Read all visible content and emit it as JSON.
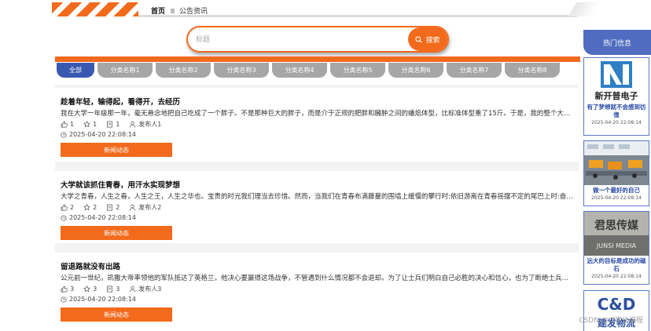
{
  "breadcrumb": {
    "home": "首页",
    "current": "公告资讯"
  },
  "search": {
    "placeholder": "标题",
    "button_label": "搜索"
  },
  "tabs": [
    {
      "label": "全部",
      "active": true
    },
    {
      "label": "分类名称1"
    },
    {
      "label": "分类名称2"
    },
    {
      "label": "分类名称3"
    },
    {
      "label": "分类名称4"
    },
    {
      "label": "分类名称5"
    },
    {
      "label": "分类名称6"
    },
    {
      "label": "分类名称7"
    },
    {
      "label": "分类名称8"
    }
  ],
  "news": [
    {
      "title": "趁着年轻，输得起，看得开，去经历",
      "desc": "我在大学一年级那一年，毫无悬念地把自己吃成了一个胖子。不是那种巨大的胖子，而是介于正规的肥胖和臃肿之间的蟠焰体型，比标准体型重了15斤。于是，我的整个大学生...",
      "likes": "1",
      "favorites": "1",
      "comments": "1",
      "author": "发布人1",
      "time": "2025-04-20 22:08:14",
      "tag": "新闻动态"
    },
    {
      "title": "大学就该抓住青春，用汗水实现梦想",
      "desc": "大学之青春，人生之春，人生之王，人生之华也。宝贵的时光我们理当去珍惜。然而，当我们在青春布满藤蔓的围墙上缓慢的攀行时:依旧游离在青春摇摆不定的尾巴上时:奋力想...",
      "likes": "2",
      "favorites": "2",
      "comments": "2",
      "author": "发布人2",
      "time": "2025-04-20 22:08:14",
      "tag": "新闻动态"
    },
    {
      "title": "留退路就没有出路",
      "desc": "公元前一世纪，凯撒大帝率领他的军队抵达了英格兰，他决心要赢得这场战争，不管遇到什么情况都不会退却。为了让士兵们明白自己必胜的决心和信心，也为了断绝士兵们逃...",
      "likes": "3",
      "favorites": "3",
      "comments": "3",
      "author": "发布人3",
      "time": "2025-04-20 22:08:14",
      "tag": "新闻动态"
    }
  ],
  "sidebar": {
    "title": "热门信息",
    "items": [
      {
        "caption": "有了梦想就不会感到彷徨",
        "date": "2025-04-20 22:08:14",
        "image": "newpower-logo",
        "image_text": "新开普电子"
      },
      {
        "caption": "做一个最好的自己",
        "date": "2025-04-20 22:08:14",
        "image": "office-photo"
      },
      {
        "caption": "远大的目标是成功的磁石",
        "date": "2025-04-20 22:08:14",
        "image": "junsi-media-sign",
        "image_text_1": "君思传媒",
        "image_text_2": "JUNSI MEDIA"
      },
      {
        "image": "cd-logistics-logo",
        "image_text_1": "C&D",
        "image_text_2": "建发物流"
      }
    ]
  },
  "watermark": "CSDN @IT学长编程",
  "colors": {
    "accent": "#f26a1b",
    "active_tab": "#3a58b1",
    "tab": "#a6a6a6",
    "sidebar": "#4f6cc0"
  }
}
